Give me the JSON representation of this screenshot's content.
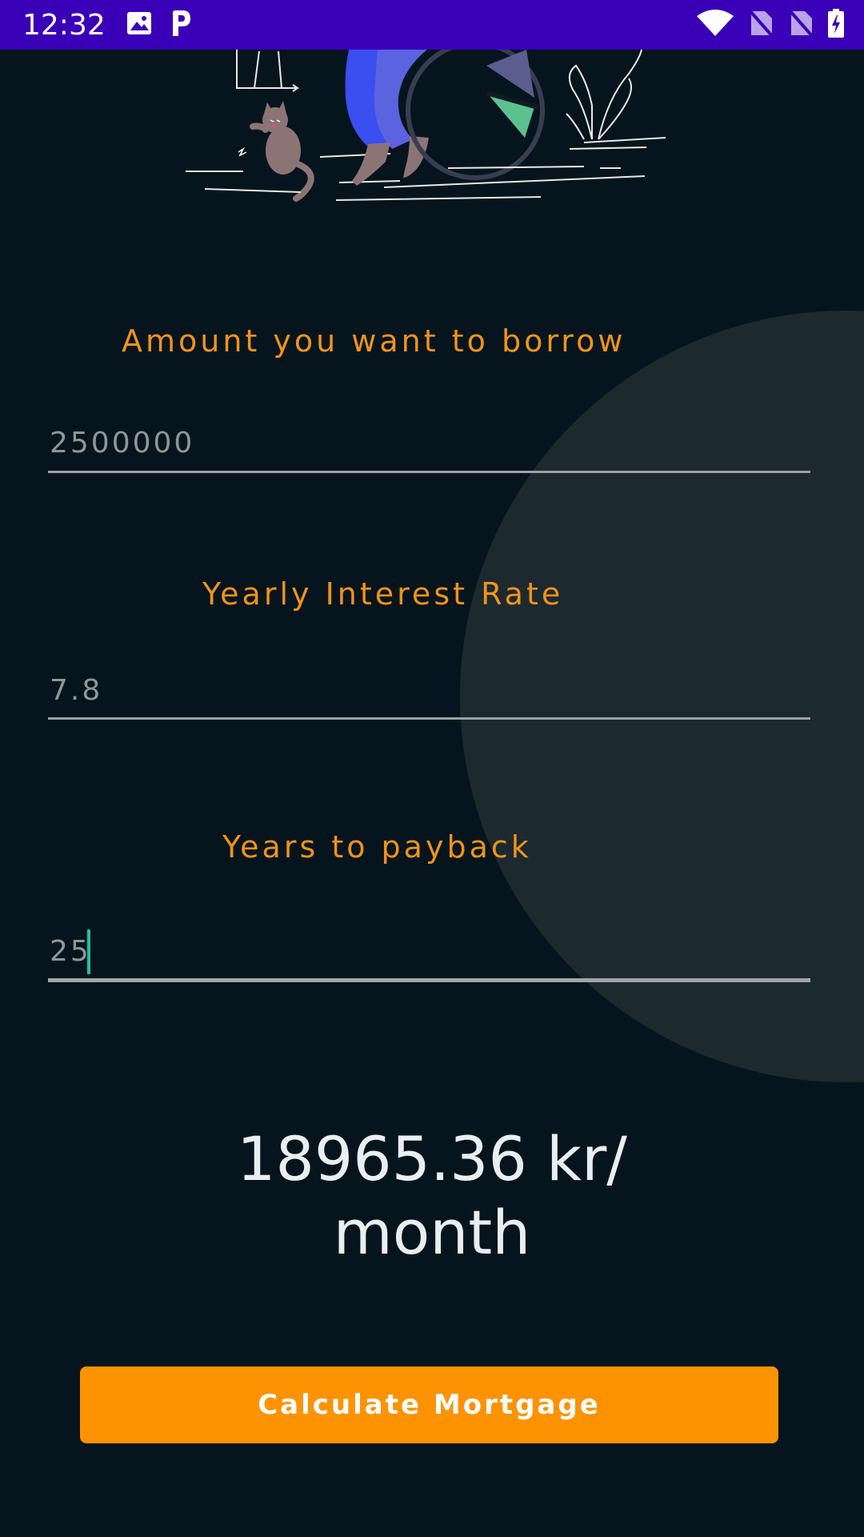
{
  "status_bar": {
    "time": "12:32",
    "icons": [
      "image-icon",
      "p-app-icon",
      "wifi-icon",
      "no-sim-icon",
      "no-sim-icon",
      "battery-charging-icon"
    ]
  },
  "form": {
    "amount": {
      "label": "Amount you want to borrow",
      "value": "2500000"
    },
    "interest": {
      "label": "Yearly Interest Rate",
      "value": "7.8"
    },
    "years": {
      "label": "Years to payback",
      "value": "25"
    }
  },
  "result": {
    "line1": "18965.36 kr/",
    "line2": "month"
  },
  "calculate_button": {
    "label": "Calculate Mortgage"
  },
  "colors": {
    "status_bar": "#3a00b8",
    "background": "#06151d",
    "accent": "#fd9302",
    "label": "#f0931a",
    "cursor": "#1fc1a5"
  }
}
